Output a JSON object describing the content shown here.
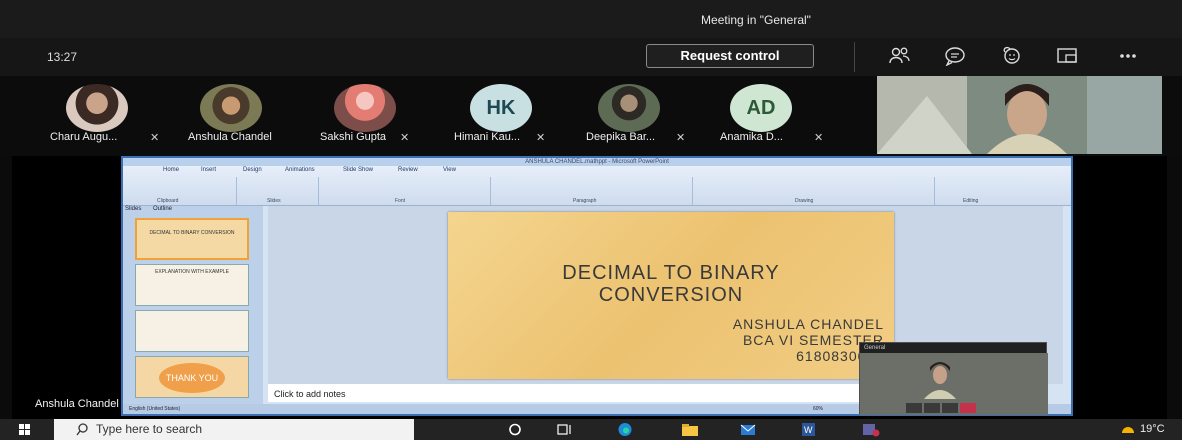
{
  "window": {
    "title": "Meeting in \"General\""
  },
  "controls": {
    "time": "13:27",
    "request_control": "Request control",
    "icons": [
      "people-icon",
      "chat-icon",
      "reactions-icon",
      "share-icon",
      "more-icon"
    ]
  },
  "participants": [
    {
      "name": "Charu Augu...",
      "initials": "",
      "muted": true
    },
    {
      "name": "Anshula Chandel",
      "initials": "",
      "muted": false
    },
    {
      "name": "Sakshi Gupta",
      "initials": "",
      "muted": true
    },
    {
      "name": "Himani Kau...",
      "initials": "HK",
      "muted": true
    },
    {
      "name": "Deepika Bar...",
      "initials": "",
      "muted": true
    },
    {
      "name": "Anamika D...",
      "initials": "AD",
      "muted": true
    }
  ],
  "presenter": {
    "name": "Anshula Chandel"
  },
  "powerpoint": {
    "title_bar": "ANSHULA CHANDEL.mathppt - Microsoft PowerPoint",
    "tabs": [
      "Home",
      "Insert",
      "Design",
      "Animations",
      "Slide Show",
      "Review",
      "View"
    ],
    "groups": [
      "Clipboard",
      "Slides",
      "Font",
      "Paragraph",
      "Drawing",
      "Editing"
    ],
    "panel_tabs": [
      "Slides",
      "Outline"
    ],
    "thumbnails": [
      {
        "text": "DECIMAL TO BINARY CONVERSION"
      },
      {
        "text": "EXPLANATION WITH EXAMPLE"
      },
      {
        "text": ""
      },
      {
        "text": "THANK YOU"
      }
    ],
    "slide": {
      "title_line1": "DECIMAL TO BINARY",
      "title_line2": "CONVERSION",
      "line1": "ANSHULA CHANDEL",
      "line2": "BCA VI SEMESTER",
      "line3": "6180830002"
    },
    "notes_placeholder": "Click to add notes",
    "status": {
      "language": "English (United States)",
      "zoom": "60%"
    }
  },
  "inset_call": {
    "label": "General"
  },
  "taskbar": {
    "search_placeholder": "Type here to search",
    "weather": "19°C"
  },
  "colors": {
    "accent_teams": "#6264a7",
    "request_border": "#8a8a8a",
    "slide_gold": "#ecc270"
  }
}
